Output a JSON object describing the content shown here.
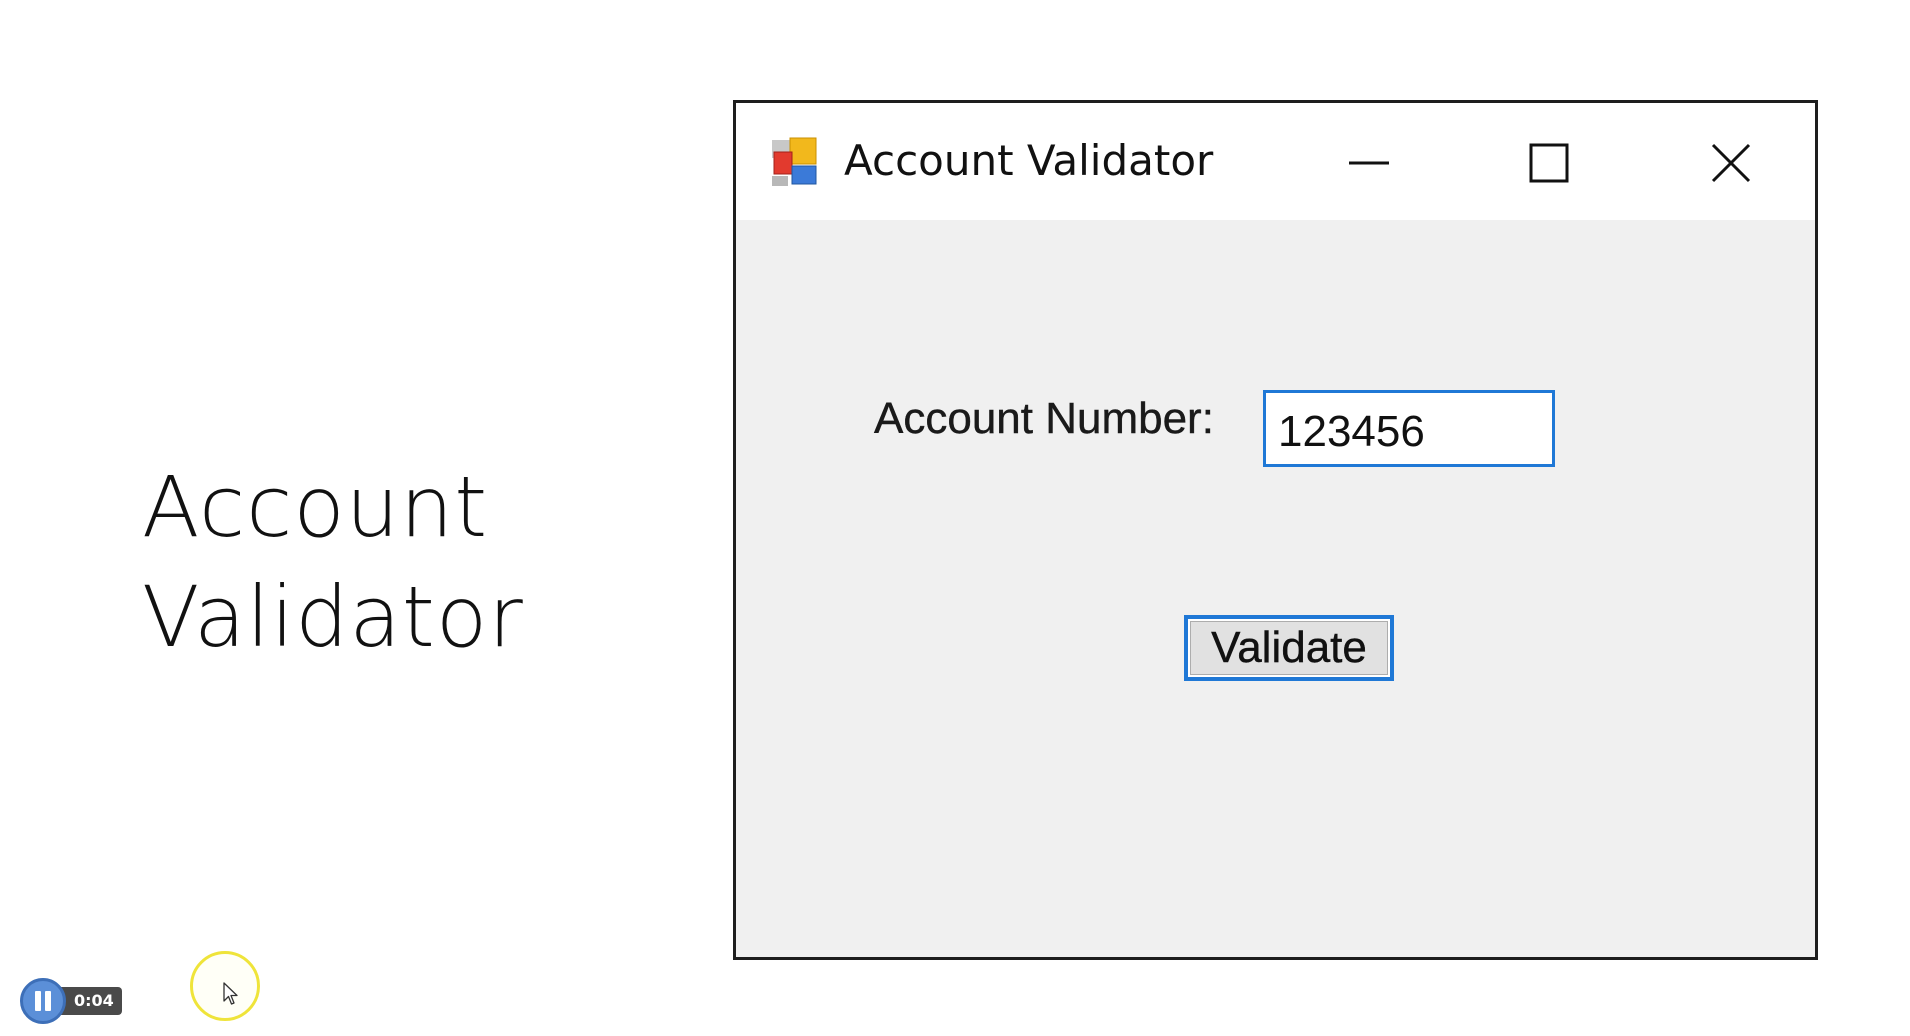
{
  "slide": {
    "title_line1": "Account",
    "title_line2": "Validator"
  },
  "window": {
    "title": "Account Validator",
    "icon": "winforms-app-icon",
    "controls": {
      "minimize": "minimize-icon",
      "maximize": "maximize-icon",
      "close": "close-icon"
    }
  },
  "form": {
    "account_label": "Account Number:",
    "account_value": "123456",
    "validate_label": "Validate"
  },
  "player": {
    "time": "0:04",
    "state_icon": "pause-icon"
  },
  "colors": {
    "focus_border": "#1f78d6",
    "window_body": "#f0f0f0",
    "titlebar": "#ffffff",
    "cursor_highlight": "#efe43a",
    "player_button": "#5b8fd8"
  }
}
